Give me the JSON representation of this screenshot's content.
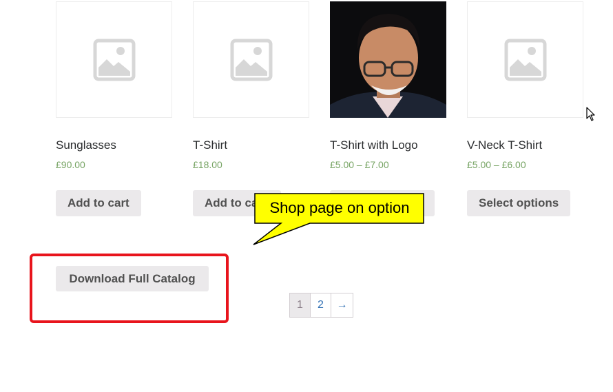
{
  "products": [
    {
      "title": "Sunglasses",
      "price": "£90.00",
      "button": "Add to cart",
      "image": "placeholder-image-icon"
    },
    {
      "title": "T-Shirt",
      "price": "£18.00",
      "button": "Add to cart",
      "image": "placeholder-image-icon"
    },
    {
      "title": "T-Shirt with Logo",
      "price": "£5.00 – £7.00",
      "button": "Select options",
      "image": "man-portrait-photo"
    },
    {
      "title": "V-Neck T-Shirt",
      "price": "£5.00 – £6.00",
      "button": "Select options",
      "image": "placeholder-image-icon"
    }
  ],
  "callout": {
    "text": "Shop page on option",
    "color": "#ffff00"
  },
  "catalog": {
    "download_label": "Download Full Catalog",
    "highlight_color": "#e8141c"
  },
  "pagination": {
    "pages": [
      "1",
      "2"
    ],
    "next": "→",
    "current": "1"
  },
  "colors": {
    "price": "#77a464",
    "button_bg": "#ebe9eb",
    "link": "#2f6fb3"
  }
}
